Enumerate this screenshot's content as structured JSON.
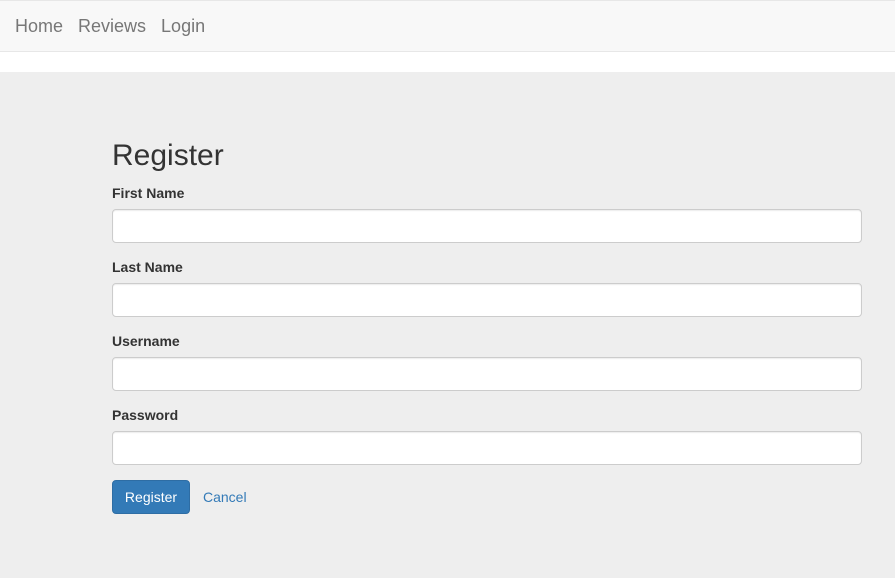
{
  "nav": {
    "items": [
      {
        "label": "Home"
      },
      {
        "label": "Reviews"
      },
      {
        "label": "Login"
      }
    ]
  },
  "form": {
    "title": "Register",
    "fields": [
      {
        "label": "First Name",
        "value": ""
      },
      {
        "label": "Last Name",
        "value": ""
      },
      {
        "label": "Username",
        "value": ""
      },
      {
        "label": "Password",
        "value": ""
      }
    ],
    "submit_label": "Register",
    "cancel_label": "Cancel"
  },
  "colors": {
    "primary": "#337ab7",
    "background": "#eeeeee",
    "navbar": "#f8f8f8"
  }
}
